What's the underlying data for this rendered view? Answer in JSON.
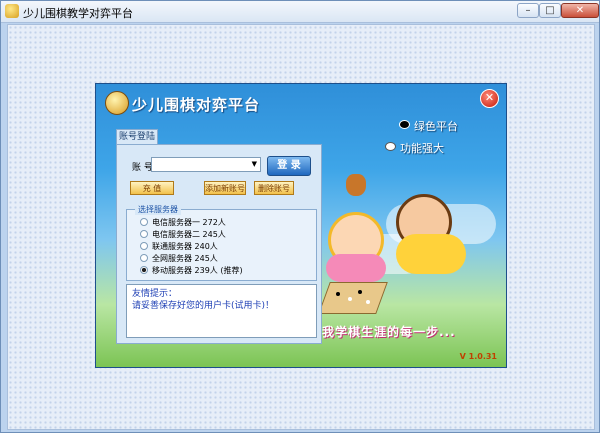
{
  "window": {
    "title": "少儿围棋教学对弈平台"
  },
  "panel": {
    "title": "少儿围棋对弈平台",
    "slogan_1": "绿色平台",
    "slogan_2": "功能强大",
    "bottom_slogan": "记录我学棋生涯的每一步...",
    "version": "V 1.0.31"
  },
  "login": {
    "tab": "账号登陆",
    "account_label": "账  号：",
    "login_button": "登 录",
    "recharge_button": "充 值",
    "add_account_button": "添加新账号",
    "delete_account_button": "删除账号",
    "server_legend": "选择服务器",
    "servers": [
      {
        "label": "电信服务器一 272人",
        "selected": false
      },
      {
        "label": "电信服务器二 245人",
        "selected": false
      },
      {
        "label": "联通服务器 240人",
        "selected": false
      },
      {
        "label": "全网服务器 245人",
        "selected": false
      },
      {
        "label": "移动服务器 239人 (推荐)",
        "selected": true
      }
    ],
    "tip_title": "友情提示：",
    "tip_body": "请妥善保存好您的用户卡(试用卡)！"
  },
  "icons": [
    "app-icon",
    "minimize-icon",
    "maximize-icon",
    "close-icon",
    "logo-icon",
    "panel-close-icon"
  ]
}
